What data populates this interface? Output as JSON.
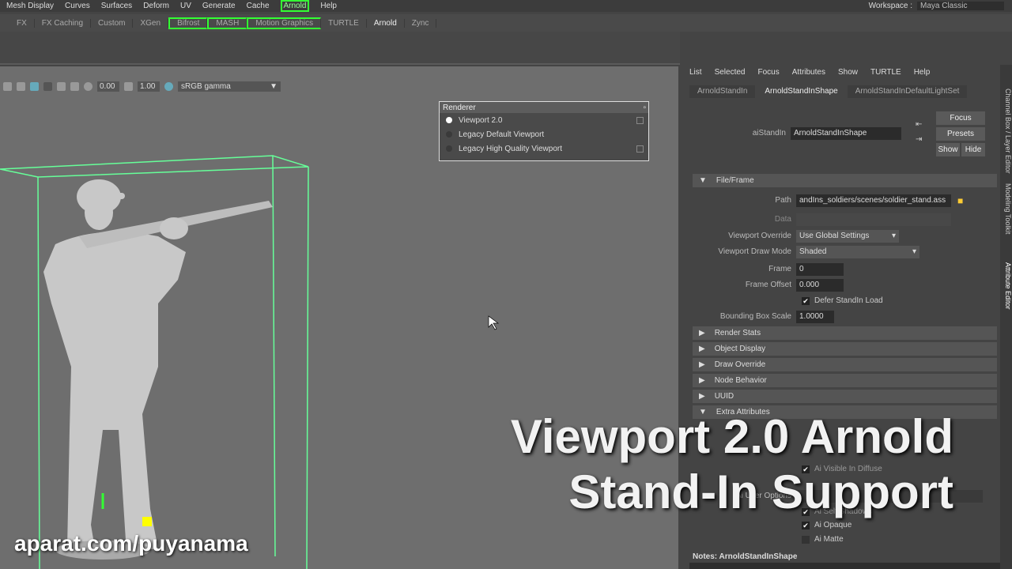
{
  "menubar": {
    "items": [
      "Mesh Display",
      "Curves",
      "Surfaces",
      "Deform",
      "UV",
      "Generate",
      "Cache",
      "Arnold",
      "Help"
    ],
    "workspace_label": "Workspace :",
    "workspace_value": "Maya Classic"
  },
  "shelf": {
    "tabs": [
      "FX",
      "FX Caching",
      "Custom",
      "XGen",
      "Bifrost",
      "MASH",
      "Motion Graphics",
      "TURTLE",
      "Arnold",
      "Zync"
    ],
    "active": "Arnold"
  },
  "viewport_toolbar": {
    "exposure": "0.00",
    "gamma": "1.00",
    "color_space": "sRGB gamma"
  },
  "renderer_popup": {
    "title": "Renderer",
    "items": [
      "Viewport 2.0",
      "Legacy Default Viewport",
      "Legacy High Quality Viewport"
    ],
    "selected": "Viewport 2.0"
  },
  "attribute_editor": {
    "menu": [
      "List",
      "Selected",
      "Focus",
      "Attributes",
      "Show",
      "TURTLE",
      "Help"
    ],
    "tabs": [
      "ArnoldStandIn",
      "ArnoldStandInShape",
      "ArnoldStandInDefaultLightSet"
    ],
    "active_tab": "ArnoldStandInShape",
    "node_label": "aiStandIn",
    "node_value": "ArnoldStandInShape",
    "buttons": {
      "focus": "Focus",
      "presets": "Presets",
      "show": "Show",
      "hide": "Hide"
    },
    "file_frame": {
      "title": "File/Frame",
      "path_label": "Path",
      "path_value": "andIns_soldiers/scenes/soldier_stand.ass",
      "data_label": "Data",
      "viewport_override_label": "Viewport Override",
      "viewport_override_value": "Use Global Settings",
      "draw_mode_label": "Viewport Draw Mode",
      "draw_mode_value": "Shaded",
      "frame_label": "Frame",
      "frame_value": "0",
      "frame_offset_label": "Frame Offset",
      "frame_offset_value": "0.000",
      "defer_label": "Defer StandIn Load",
      "bbox_label": "Bounding Box Scale",
      "bbox_value": "1.0000"
    },
    "sections": [
      "Render Stats",
      "Object Display",
      "Draw Override",
      "Node Behavior",
      "UUID"
    ],
    "extra_title": "Extra Attributes",
    "extra": {
      "visible_diffuse": "Ai Visible In Diffuse",
      "user_options": "Ai User Options",
      "opaque": "Ai Opaque",
      "matte": "Ai Matte",
      "self_shadows": "Ai Self Shadows"
    },
    "notes": "Notes: ArnoldStandInShape"
  },
  "side_tabs": [
    "Channel Box / Layer Editor",
    "Modeling Toolkit",
    "Attribute Editor"
  ],
  "caption": {
    "line1": "Viewport 2.0 Arnold",
    "line2": "Stand-In Support"
  },
  "watermark": "aparat.com/puyanama",
  "colors": {
    "bbox": "#66ff99",
    "accent": "#33ff33"
  }
}
